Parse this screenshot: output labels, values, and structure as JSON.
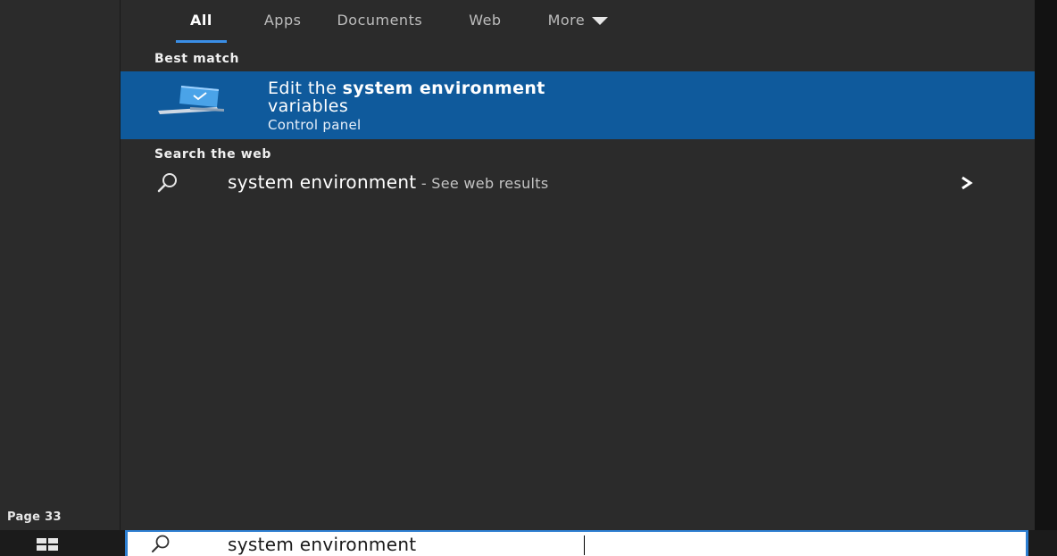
{
  "tabs": [
    {
      "label": "All",
      "active": true
    },
    {
      "label": "Apps",
      "active": false
    },
    {
      "label": "Documents",
      "active": false
    },
    {
      "label": "Web",
      "active": false
    },
    {
      "label": "More",
      "active": false,
      "has_dropdown": true
    }
  ],
  "best_match": {
    "heading": "Best match",
    "title_prefix": "Edit the ",
    "title_bold": "system environment",
    "title_suffix": "variables",
    "subtitle": "Control panel",
    "icon": "control-panel-monitor-icon"
  },
  "web_search": {
    "heading": "Search the web",
    "query": "system environment",
    "suffix": " - See web results",
    "icon": "search-icon",
    "action_icon": "chevron-right-icon"
  },
  "left_rail": {
    "page_label": "Page 33"
  },
  "taskbar": {
    "start_icon": "windows-logo-icon",
    "search_value": "system environment",
    "search_icon": "search-icon"
  },
  "colors": {
    "panel_bg": "#2b2b2b",
    "selected_bg": "#0f5a9c",
    "accent": "#3a8ee6"
  }
}
